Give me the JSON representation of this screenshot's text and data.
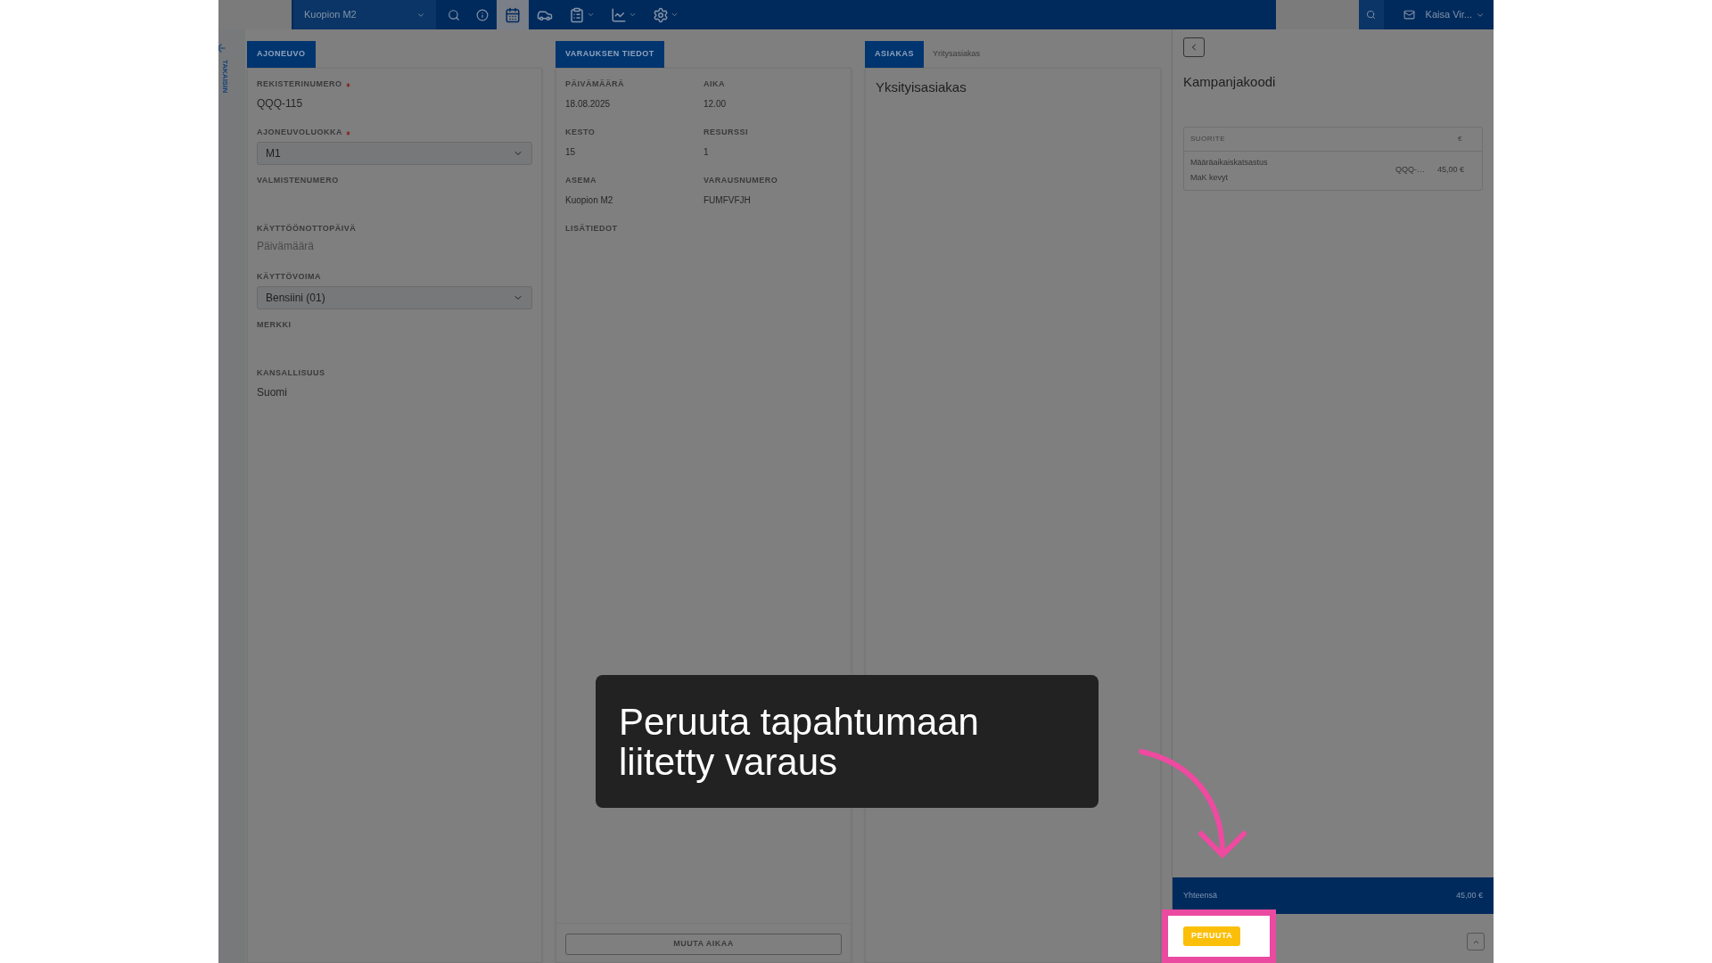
{
  "top_bar": {
    "location": "Kuopion M2",
    "tools": [
      {
        "kind": "search",
        "selected": false,
        "has_menu": false
      },
      {
        "kind": "info",
        "selected": false,
        "has_menu": false
      },
      {
        "kind": "calendar",
        "selected": true,
        "has_menu": false
      },
      {
        "kind": "car",
        "selected": false,
        "has_menu": false
      },
      {
        "kind": "clipboard",
        "selected": false,
        "has_menu": true
      },
      {
        "kind": "chart",
        "selected": false,
        "has_menu": true
      },
      {
        "kind": "settings",
        "selected": false,
        "has_menu": true
      }
    ],
    "user": "Kaisa Vir..."
  },
  "side_rail": {
    "back_label": "TAKAISIN"
  },
  "vehicle": {
    "tab": "AJONEUVO",
    "fields": [
      {
        "label": "REKISTERINUMERO",
        "required": true,
        "kind": "text",
        "value": "QQQ-115"
      },
      {
        "label": "AJONEUVOLUOKKA",
        "required": true,
        "kind": "select",
        "value": "M1"
      },
      {
        "label": "VALMISTENUMERO",
        "required": false,
        "kind": "empty"
      },
      {
        "label": "KÄYTTÖÖNOTTOPÄIVÄ",
        "required": false,
        "kind": "date",
        "placeholder": "Päivämäärä"
      },
      {
        "label": "KÄYTTÖVOIMA",
        "required": false,
        "kind": "select",
        "value": "Bensiini (01)"
      },
      {
        "label": "MERKKI",
        "required": false,
        "kind": "empty"
      },
      {
        "label": "KANSALLISUUS",
        "required": false,
        "kind": "text",
        "value": "Suomi"
      }
    ]
  },
  "booking": {
    "tab": "VARAUKSEN TIEDOT",
    "fields": [
      {
        "label": "PÄIVÄMÄÄRÄ",
        "value": "18.08.2025"
      },
      {
        "label": "AIKA",
        "value": "12.00"
      },
      {
        "label": "KESTO",
        "value": "15"
      },
      {
        "label": "RESURSSI",
        "value": "1"
      },
      {
        "label": "ASEMA",
        "value": "Kuopion M2"
      },
      {
        "label": "VARAUSNUMERO",
        "value": "FUMFVFJH"
      },
      {
        "label": "LISÄTIEDOT"
      }
    ],
    "change_time_button": "MUUTA AIKAA"
  },
  "customer": {
    "tabs": [
      {
        "label": "ASIAKAS",
        "selected": true
      },
      {
        "label": "Yritysasiakas",
        "selected": false
      }
    ],
    "heading": "Yksityisasiakas"
  },
  "cart": {
    "title": "Kampanjakoodi",
    "columns": [
      "SUORITE",
      "€"
    ],
    "rows": [
      {
        "lines": [
          "Määräaikaiskatsastus",
          "MaK kevyt"
        ],
        "column_2": "QQQ-…",
        "price": "45,00 €"
      }
    ],
    "total": {
      "label": "Yhteensä",
      "value": "45,00 €"
    },
    "cancel_button": "PERUUTA"
  },
  "tutorial": {
    "text": "Peruuta tapahtumaan liitetty varaus"
  }
}
